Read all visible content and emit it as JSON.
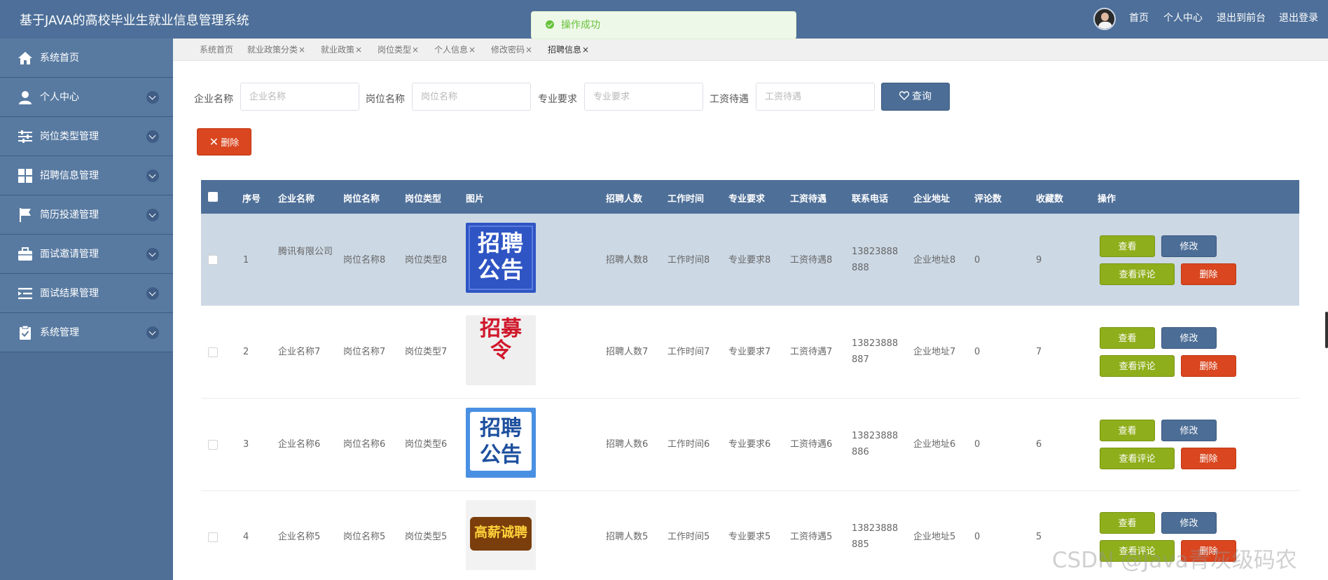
{
  "app_title": "基于JAVA的高校毕业生就业信息管理系统",
  "toast": "操作成功",
  "topnav": {
    "home": "首页",
    "profile": "个人中心",
    "frontend": "退出到前台",
    "logout": "退出登录"
  },
  "sidebar": [
    {
      "label": "系统首页",
      "icon": "home-icon"
    },
    {
      "label": "个人中心",
      "icon": "user-icon"
    },
    {
      "label": "岗位类型管理",
      "icon": "sliders-icon"
    },
    {
      "label": "招聘信息管理",
      "icon": "grid-icon"
    },
    {
      "label": "简历投递管理",
      "icon": "flag-icon"
    },
    {
      "label": "面试邀请管理",
      "icon": "briefcase-icon"
    },
    {
      "label": "面试结果管理",
      "icon": "list-indent-icon"
    },
    {
      "label": "系统管理",
      "icon": "clipboard-icon"
    }
  ],
  "tabs": [
    "系统首页",
    "就业政策分类",
    "就业政策",
    "岗位类型",
    "个人信息",
    "修改密码",
    "招聘信息"
  ],
  "tab_close": "×",
  "filters": [
    {
      "label": "企业名称",
      "placeholder": "企业名称"
    },
    {
      "label": "岗位名称",
      "placeholder": "岗位名称"
    },
    {
      "label": "专业要求",
      "placeholder": "专业要求"
    },
    {
      "label": "工资待遇",
      "placeholder": "工资待遇"
    }
  ],
  "query_label": "查询",
  "delete_label": "删除",
  "columns": [
    "序号",
    "企业名称",
    "岗位名称",
    "岗位类型",
    "图片",
    "招聘人数",
    "工作时间",
    "专业要求",
    "工资待遇",
    "联系电话",
    "企业地址",
    "评论数",
    "收藏数",
    "操作"
  ],
  "actions": {
    "view": "查看",
    "edit": "修改",
    "comment": "查看评论",
    "delete": "删除"
  },
  "rows": [
    {
      "no": "1",
      "company": "腾讯有限公司",
      "post": "岗位名称8",
      "ptype": "岗位类型8",
      "pic_text": "招聘公告",
      "count": "招聘人数8",
      "worktime": "工作时间8",
      "major": "专业要求8",
      "salary": "工资待遇8",
      "phone": "13823888888",
      "address": "企业地址8",
      "comments": "0",
      "favs": "9"
    },
    {
      "no": "2",
      "company": "企业名称7",
      "post": "岗位名称7",
      "ptype": "岗位类型7",
      "pic_text": "招募令",
      "count": "招聘人数7",
      "worktime": "工作时间7",
      "major": "专业要求7",
      "salary": "工资待遇7",
      "phone": "13823888887",
      "address": "企业地址7",
      "comments": "0",
      "favs": "7"
    },
    {
      "no": "3",
      "company": "企业名称6",
      "post": "岗位名称6",
      "ptype": "岗位类型6",
      "pic_text": "招聘公告",
      "count": "招聘人数6",
      "worktime": "工作时间6",
      "major": "专业要求6",
      "salary": "工资待遇6",
      "phone": "13823888886",
      "address": "企业地址6",
      "comments": "0",
      "favs": "6"
    },
    {
      "no": "4",
      "company": "企业名称5",
      "post": "岗位名称5",
      "ptype": "岗位类型5",
      "pic_text": "高薪诚聘",
      "count": "招聘人数5",
      "worktime": "工作时间5",
      "major": "专业要求5",
      "salary": "工资待遇5",
      "phone": "13823888885",
      "address": "企业地址5",
      "comments": "0",
      "favs": "5"
    }
  ],
  "watermark": "CSDN @Java青灰级码农",
  "colors": {
    "header": "#4d6f99",
    "sidebar": "#587aa1",
    "view": "#8fae1b",
    "edit": "#4b6d96",
    "delete": "#d9461f",
    "selected_row": "#ccd8e4"
  }
}
